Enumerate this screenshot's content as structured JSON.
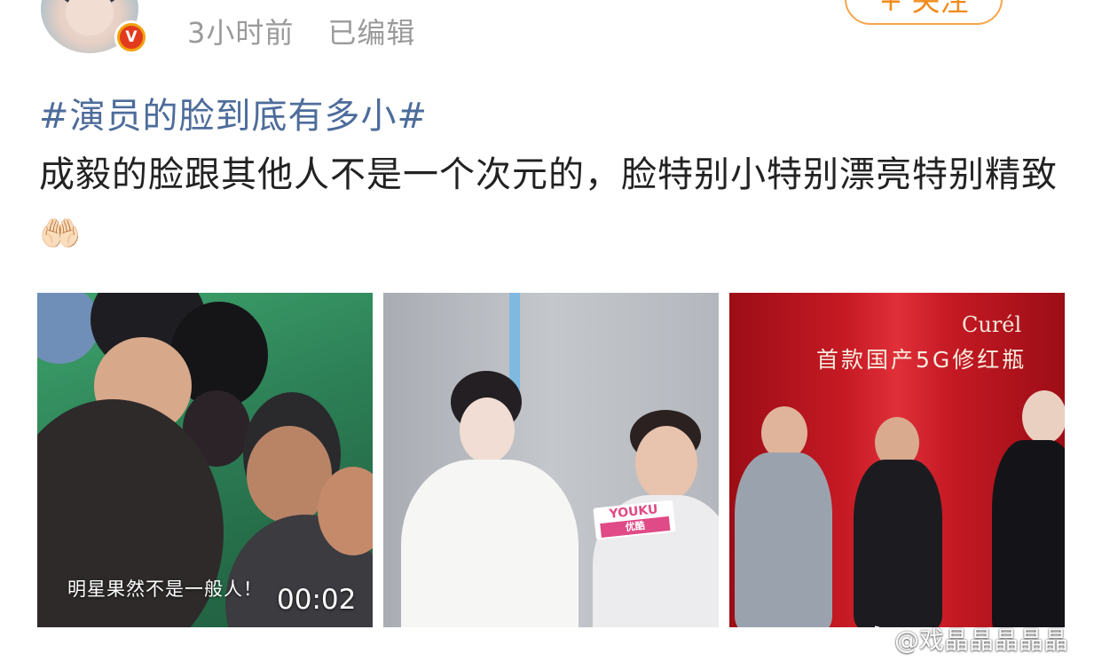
{
  "header": {
    "verified_badge": "V",
    "time_ago": "3小时前",
    "edited": "已编辑",
    "follow_label": "+ 关注",
    "accent_color": "#f28a1a"
  },
  "post": {
    "topic": "#演员的脸到底有多小#",
    "text": "成毅的脸跟其他人不是一个次元的，脸特别小特别漂亮特别精致",
    "emoji": "🤲🏻",
    "topic_color": "#4d6c9b"
  },
  "media": [
    {
      "type": "video",
      "caption": "明星果然不是一般人！",
      "duration": "00:02"
    },
    {
      "type": "image",
      "mic_flag_top": "YOUKU",
      "mic_flag_sub": "优酷"
    },
    {
      "type": "image",
      "brand": "Curél",
      "slogan": "首款国产5G修红瓶"
    }
  ],
  "watermark": {
    "icon": "weibo-icon",
    "text": "@戏晶晶晶晶晶"
  }
}
